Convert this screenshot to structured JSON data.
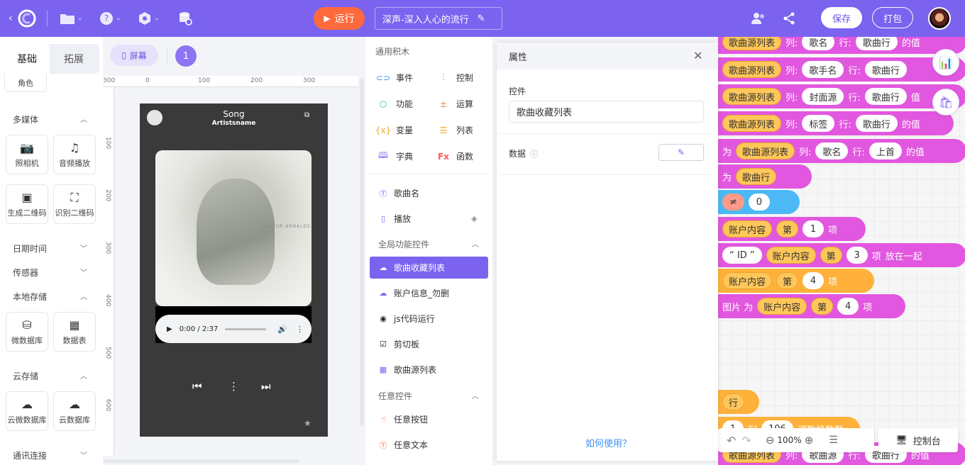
{
  "topbar": {
    "run_label": "运行",
    "project_name": "深声-深入人心的流行",
    "save_label": "保存",
    "pack_label": "打包"
  },
  "left_panel": {
    "tabs": [
      "基础",
      "拓展"
    ],
    "partial_item": "角色",
    "sections": {
      "multimedia": {
        "title": "多媒体",
        "items": [
          "照相机",
          "音频播放",
          "生成二维码",
          "识别二维码"
        ]
      },
      "datetime": {
        "title": "日期时间"
      },
      "sensor": {
        "title": "传感器"
      },
      "local_storage": {
        "title": "本地存储",
        "items": [
          "微数据库",
          "数据表"
        ]
      },
      "cloud_storage": {
        "title": "云存储",
        "items": [
          "云微数据库",
          "云数据库"
        ]
      },
      "comm": {
        "title": "通讯连接"
      }
    }
  },
  "stage": {
    "screen_label": "屏幕",
    "screen_number": "1",
    "hruler": [
      "300",
      "0",
      "100",
      "200",
      "300"
    ],
    "vruler": [
      "100",
      "200",
      "300",
      "400",
      "500",
      "600"
    ],
    "phone": {
      "title": "Song",
      "subtitle": "Artistsname",
      "album_text": "ÓLAFUR ARNALDS",
      "time_display": "0:00 / 2:37"
    }
  },
  "blocks_panel": {
    "general_title": "通用积木",
    "categories": [
      {
        "label": "事件",
        "color": "#3b8ff6"
      },
      {
        "label": "控制",
        "color": "#3b8ff6"
      },
      {
        "label": "功能",
        "color": "#1fb5a6"
      },
      {
        "label": "运算",
        "color": "#ff7a45"
      },
      {
        "label": "变量",
        "color": "#f5a623"
      },
      {
        "label": "列表",
        "color": "#f5a623"
      },
      {
        "label": "字典",
        "color": "#8c74f3"
      },
      {
        "label": "函数",
        "color": "#ff5a5a"
      }
    ],
    "component_items": [
      "歌曲名",
      "播放"
    ],
    "global_title": "全局功能控件",
    "global_items": [
      "歌曲收藏列表",
      "账户信息_勿删",
      "js代码运行",
      "剪切板",
      "歌曲源列表"
    ],
    "any_title": "任意控件",
    "any_items": [
      "任意按钮",
      "任意文本"
    ]
  },
  "properties": {
    "title": "属性",
    "control_label": "控件",
    "control_value": "歌曲收藏列表",
    "data_label": "数据",
    "help_link": "如何使用？"
  },
  "canvas": {
    "r1": {
      "a": "歌曲源列表",
      "b": "列:",
      "c": "歌名",
      "d": "行:",
      "e": "歌曲行",
      "f": "的值"
    },
    "r2": {
      "a": "歌曲源列表",
      "b": "列:",
      "c": "歌手名",
      "d": "行:",
      "e": "歌曲行"
    },
    "r3": {
      "a": "歌曲源列表",
      "b": "列:",
      "c": "封面源",
      "d": "行:",
      "e": "歌曲行",
      "f": "值"
    },
    "r4": {
      "a": "歌曲源列表",
      "b": "列:",
      "c": "标签",
      "d": "行:",
      "e": "歌曲行",
      "f": "的值"
    },
    "r5": {
      "w": "为",
      "a": "歌曲源列表",
      "b": "列:",
      "c": "歌名",
      "d": "行:",
      "e": "上首",
      "f": "的值"
    },
    "r6": {
      "w": "为",
      "a": "歌曲行"
    },
    "r7": {
      "op": "≠",
      "v": "0"
    },
    "r8": {
      "a": "账户内容",
      "b": "第",
      "v": "1",
      "c": "项"
    },
    "r9": {
      "q": "“ ID ”",
      "a": "账户内容",
      "b": "第",
      "v": "3",
      "c": "项",
      "d": "放在一起"
    },
    "r10": {
      "a": "账户内容",
      "b": "第",
      "v": "4",
      "c": "项"
    },
    "r11": {
      "w": "图片 为",
      "a": "账户内容",
      "b": "第",
      "v": "4",
      "c": "项"
    },
    "r12": {
      "a": "行"
    },
    "r13": {
      "a": "1",
      "b": "列",
      "c": "106",
      "d": "调数机数数"
    },
    "r14": {
      "a": "歌曲源列表",
      "b": "列:",
      "c": "歌曲源",
      "d": "行:",
      "e": "歌曲行",
      "f": "的值"
    },
    "zoom": "100%",
    "console_label": "控制台"
  }
}
